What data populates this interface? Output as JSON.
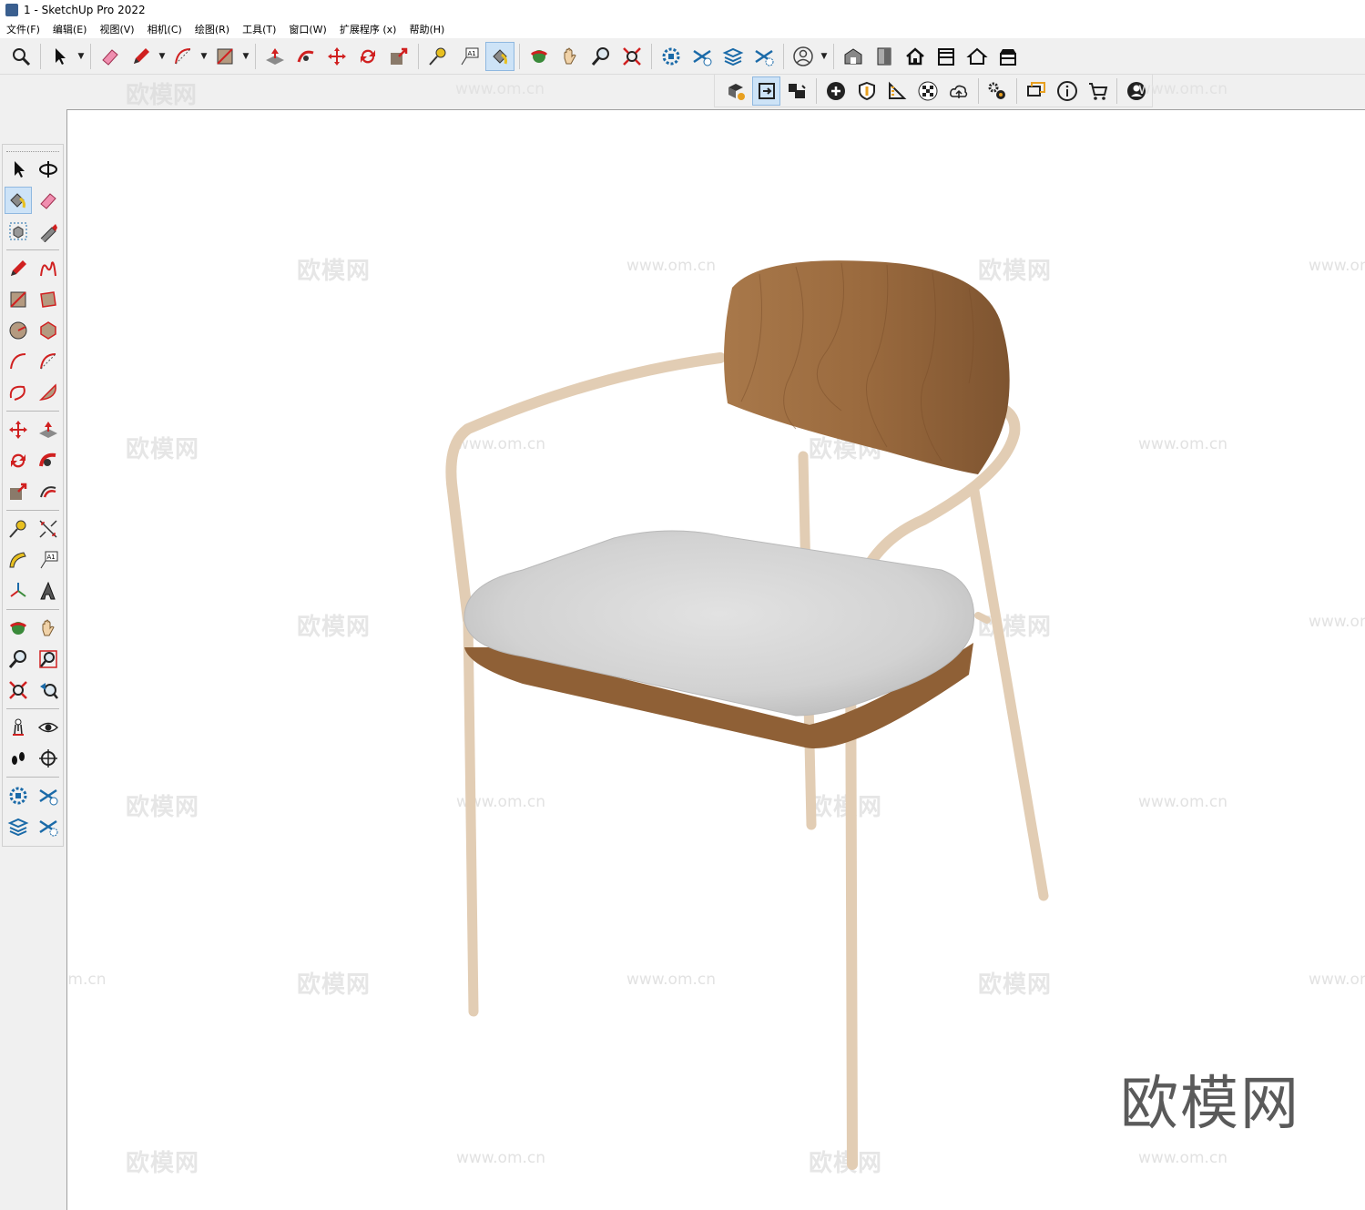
{
  "window": {
    "title": "1 - SketchUp Pro 2022"
  },
  "menu": [
    "文件(F)",
    "编辑(E)",
    "视图(V)",
    "相机(C)",
    "绘图(R)",
    "工具(T)",
    "窗口(W)",
    "扩展程序 (x)",
    "帮助(H)"
  ],
  "toolbar_top": {
    "tools": [
      "zoom-extents-icon",
      "select-icon",
      "eraser-icon",
      "pencil-icon",
      "arc-icon",
      "rectangle-icon",
      "push-pull-icon",
      "follow-me-icon",
      "move-icon",
      "rotate-icon",
      "scale-icon",
      "tape-measure-icon",
      "text-icon",
      "paint-bucket-icon",
      "orbit-icon",
      "pan-icon",
      "zoom-icon",
      "zoom-window-icon",
      "component-icon",
      "layer-icon",
      "tags-icon",
      "settings-icon",
      "account-icon",
      "warehouse-icon",
      "door-icon",
      "home-icon",
      "house-icon",
      "roof-icon",
      "shed-icon"
    ]
  },
  "toolbar_second": {
    "tools": [
      "components-play-icon",
      "layout-icon",
      "video-icon",
      "add-icon",
      "shield-icon",
      "ruler-icon",
      "checker-icon",
      "cloud-icon",
      "gears-icon",
      "chat-icon",
      "info-icon",
      "cart-icon",
      "user-icon"
    ]
  },
  "left_toolbar": {
    "tools": [
      "select-icon",
      "orbit-icon",
      "paint-bucket-icon",
      "eraser-icon",
      "component-icon",
      "tape-icon",
      "line-icon",
      "freehand-icon",
      "rectangle-icon",
      "rotated-rect-icon",
      "circle-icon",
      "polygon-icon",
      "arc-icon",
      "arc-2pt-icon",
      "arc-3pt-icon",
      "pie-icon",
      "move-icon",
      "push-pull-icon",
      "rotate-icon",
      "follow-me-icon",
      "scale-icon",
      "offset-icon",
      "tape-measure-icon",
      "dimension-icon",
      "protractor-icon",
      "text-icon",
      "axes-icon",
      "3d-text-icon",
      "orbit-view-icon",
      "pan-icon",
      "zoom-icon",
      "zoom-window-icon",
      "zoom-extents-icon",
      "previous-view-icon",
      "position-camera-icon",
      "look-around-icon",
      "walk-icon",
      "section-plane-icon",
      "outliner-icon",
      "tags-icon",
      "layers-icon",
      "settings-icon"
    ]
  },
  "watermarks": {
    "brand": "欧模网",
    "site": "www.om.cn",
    "cn": "欧模网",
    "partial_site": "om.cn"
  },
  "colors": {
    "accent": "#cde3f7",
    "wood": "#9a6a3e",
    "frame": "#e2cdb4",
    "cushion": "#dcdcdc"
  }
}
